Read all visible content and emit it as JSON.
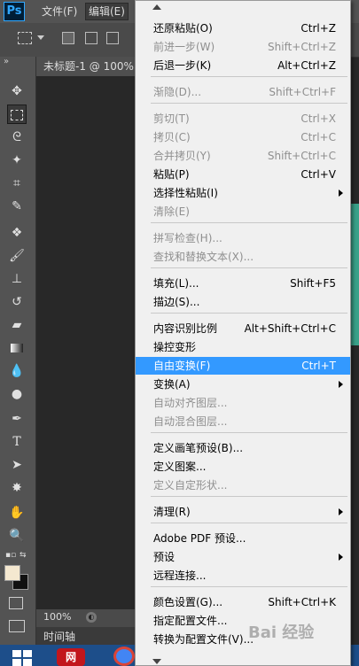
{
  "app": {
    "logo_text": "Ps"
  },
  "menubar": {
    "file": "文件(F)",
    "edit": "编辑(E)"
  },
  "document": {
    "tab_title": "未标题-1 @ 100%",
    "zoom": "100%"
  },
  "timeline": {
    "label": "时间轴"
  },
  "toolbar": {
    "icons": [
      "move-icon",
      "rectangular-marquee-icon",
      "lasso-icon",
      "magic-wand-icon",
      "crop-icon",
      "eyedropper-icon",
      "spot-healing-icon",
      "brush-icon",
      "clone-stamp-icon",
      "history-brush-icon",
      "eraser-icon",
      "gradient-icon",
      "blur-icon",
      "dodge-icon",
      "pen-icon",
      "type-icon",
      "path-selection-icon",
      "custom-shape-icon",
      "hand-icon",
      "zoom-icon"
    ]
  },
  "taskbar": {
    "netease_glyph": "网"
  },
  "watermark": {
    "text": "Bai 经验"
  },
  "colors": {
    "menu_highlight": "#3399ff",
    "menu_bg": "#f0f0f0",
    "disabled_text": "#8f8f8f"
  },
  "edit_menu": {
    "items": [
      {
        "label": "还原粘贴(O)",
        "shortcut": "Ctrl+Z",
        "disabled": false
      },
      {
        "label": "前进一步(W)",
        "shortcut": "Shift+Ctrl+Z",
        "disabled": true
      },
      {
        "label": "后退一步(K)",
        "shortcut": "Alt+Ctrl+Z",
        "disabled": false
      },
      {
        "label": "渐隐(D)...",
        "shortcut": "Shift+Ctrl+F",
        "disabled": true
      },
      {
        "label": "剪切(T)",
        "shortcut": "Ctrl+X",
        "disabled": true
      },
      {
        "label": "拷贝(C)",
        "shortcut": "Ctrl+C",
        "disabled": true
      },
      {
        "label": "合并拷贝(Y)",
        "shortcut": "Shift+Ctrl+C",
        "disabled": true
      },
      {
        "label": "粘贴(P)",
        "shortcut": "Ctrl+V",
        "disabled": false
      },
      {
        "label": "选择性粘贴(I)",
        "shortcut": "",
        "disabled": false,
        "submenu": true
      },
      {
        "label": "清除(E)",
        "shortcut": "",
        "disabled": true
      },
      {
        "label": "拼写检查(H)...",
        "shortcut": "",
        "disabled": true
      },
      {
        "label": "查找和替换文本(X)...",
        "shortcut": "",
        "disabled": true
      },
      {
        "label": "填充(L)...",
        "shortcut": "Shift+F5",
        "disabled": false
      },
      {
        "label": "描边(S)...",
        "shortcut": "",
        "disabled": false
      },
      {
        "label": "内容识别比例",
        "shortcut": "Alt+Shift+Ctrl+C",
        "disabled": false
      },
      {
        "label": "操控变形",
        "shortcut": "",
        "disabled": false
      },
      {
        "label": "自由变换(F)",
        "shortcut": "Ctrl+T",
        "disabled": false,
        "highlighted": true
      },
      {
        "label": "变换(A)",
        "shortcut": "",
        "disabled": false,
        "submenu": true
      },
      {
        "label": "自动对齐图层...",
        "shortcut": "",
        "disabled": true
      },
      {
        "label": "自动混合图层...",
        "shortcut": "",
        "disabled": true
      },
      {
        "label": "定义画笔预设(B)...",
        "shortcut": "",
        "disabled": false
      },
      {
        "label": "定义图案...",
        "shortcut": "",
        "disabled": false
      },
      {
        "label": "定义自定形状...",
        "shortcut": "",
        "disabled": true
      },
      {
        "label": "清理(R)",
        "shortcut": "",
        "disabled": false,
        "submenu": true
      },
      {
        "label": "Adobe PDF 预设...",
        "shortcut": "",
        "disabled": false
      },
      {
        "label": "预设",
        "shortcut": "",
        "disabled": false,
        "submenu": true
      },
      {
        "label": "远程连接...",
        "shortcut": "",
        "disabled": false
      },
      {
        "label": "颜色设置(G)...",
        "shortcut": "Shift+Ctrl+K",
        "disabled": false
      },
      {
        "label": "指定配置文件...",
        "shortcut": "",
        "disabled": false
      },
      {
        "label": "转换为配置文件(V)...",
        "shortcut": "",
        "disabled": false
      }
    ]
  }
}
